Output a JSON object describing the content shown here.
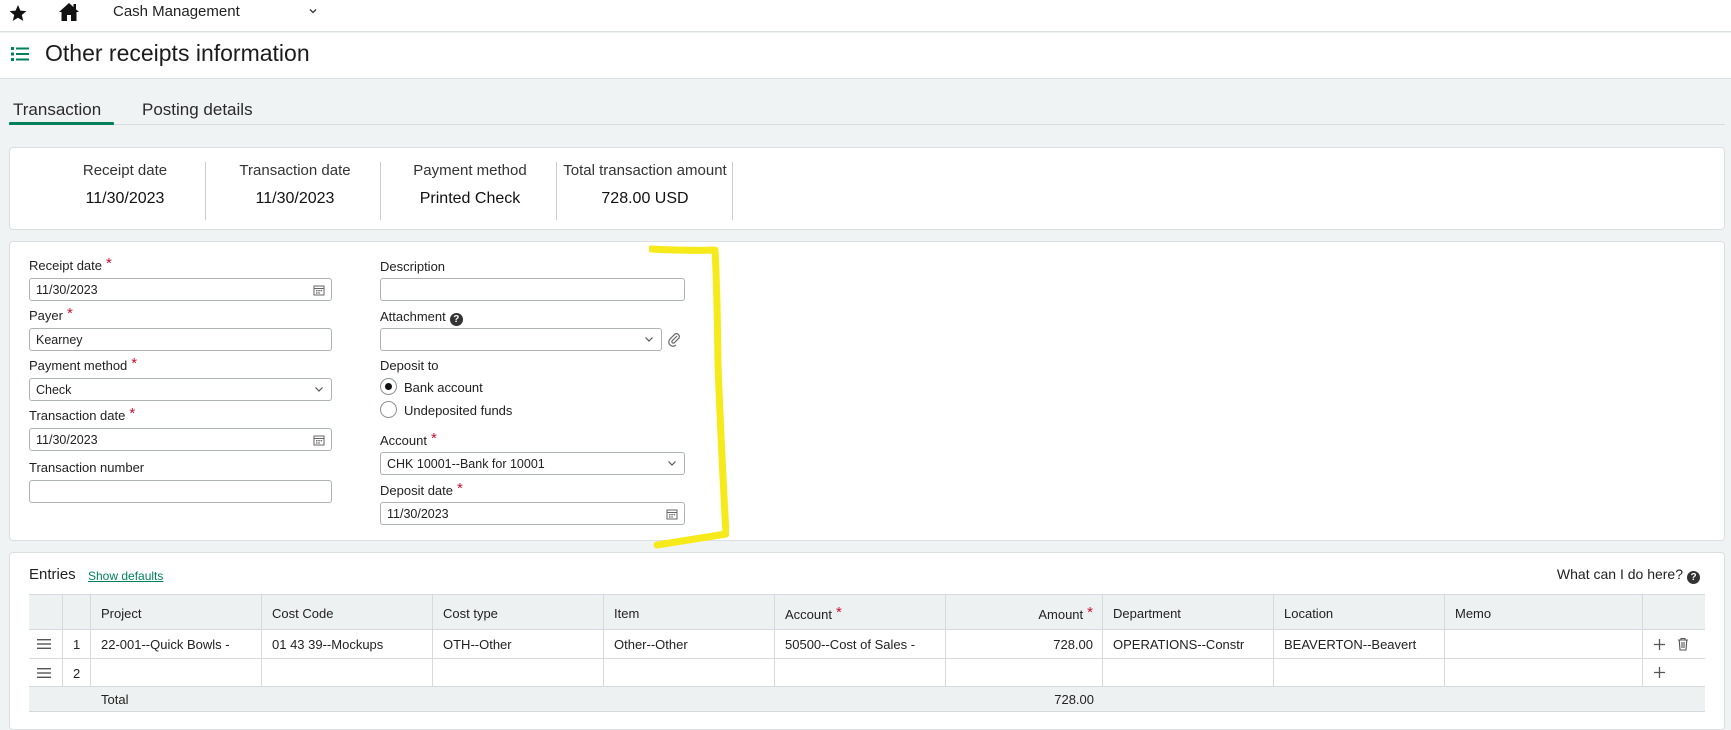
{
  "topbar": {
    "module": "Cash Management",
    "icons": [
      "star-icon",
      "home-icon",
      "chevron-down-icon"
    ]
  },
  "header": {
    "title": "Other receipts information",
    "icon": "list-icon"
  },
  "tabs": [
    {
      "label": "Transaction",
      "active": true
    },
    {
      "label": "Posting details",
      "active": false
    }
  ],
  "summary": [
    {
      "label": "Receipt date",
      "value": "11/30/2023"
    },
    {
      "label": "Transaction date",
      "value": "11/30/2023"
    },
    {
      "label": "Payment method",
      "value": "Printed Check"
    },
    {
      "label": "Total transaction amount",
      "value": "728.00 USD"
    }
  ],
  "form": {
    "receipt_date": {
      "label": "Receipt date",
      "value": "11/30/2023"
    },
    "payer": {
      "label": "Payer",
      "value": "Kearney"
    },
    "payment_method": {
      "label": "Payment method",
      "value": "Check"
    },
    "transaction_date": {
      "label": "Transaction date",
      "value": "11/30/2023"
    },
    "transaction_number": {
      "label": "Transaction number",
      "value": ""
    },
    "description": {
      "label": "Description",
      "value": ""
    },
    "attachment": {
      "label": "Attachment",
      "value": ""
    },
    "deposit_to": {
      "label": "Deposit to",
      "options": [
        {
          "label": "Bank account",
          "checked": true
        },
        {
          "label": "Undeposited funds",
          "checked": false
        }
      ]
    },
    "account": {
      "label": "Account",
      "value": "CHK 10001--Bank for 10001"
    },
    "deposit_date": {
      "label": "Deposit date",
      "value": "11/30/2023"
    }
  },
  "entries": {
    "title": "Entries",
    "show_defaults": "Show defaults",
    "help": "What can I do here?",
    "columns": [
      "Project",
      "Cost Code",
      "Cost type",
      "Item",
      "Account",
      "Amount",
      "Department",
      "Location",
      "Memo"
    ],
    "rows": [
      {
        "num": "1",
        "project": "22-001--Quick Bowls -",
        "cost_code": "01 43 39--Mockups",
        "cost_type": "OTH--Other",
        "item": "Other--Other",
        "account": "50500--Cost of Sales -",
        "amount": "728.00",
        "department": "OPERATIONS--Constr",
        "location": "BEAVERTON--Beavert",
        "memo": ""
      },
      {
        "num": "2",
        "project": "",
        "cost_code": "",
        "cost_type": "",
        "item": "",
        "account": "",
        "amount": "",
        "department": "",
        "location": "",
        "memo": ""
      }
    ],
    "total_label": "Total",
    "total_amount": "728.00"
  },
  "colors": {
    "accent": "#00815d",
    "required": "#c8102e",
    "highlight": "#f7ea1a"
  }
}
